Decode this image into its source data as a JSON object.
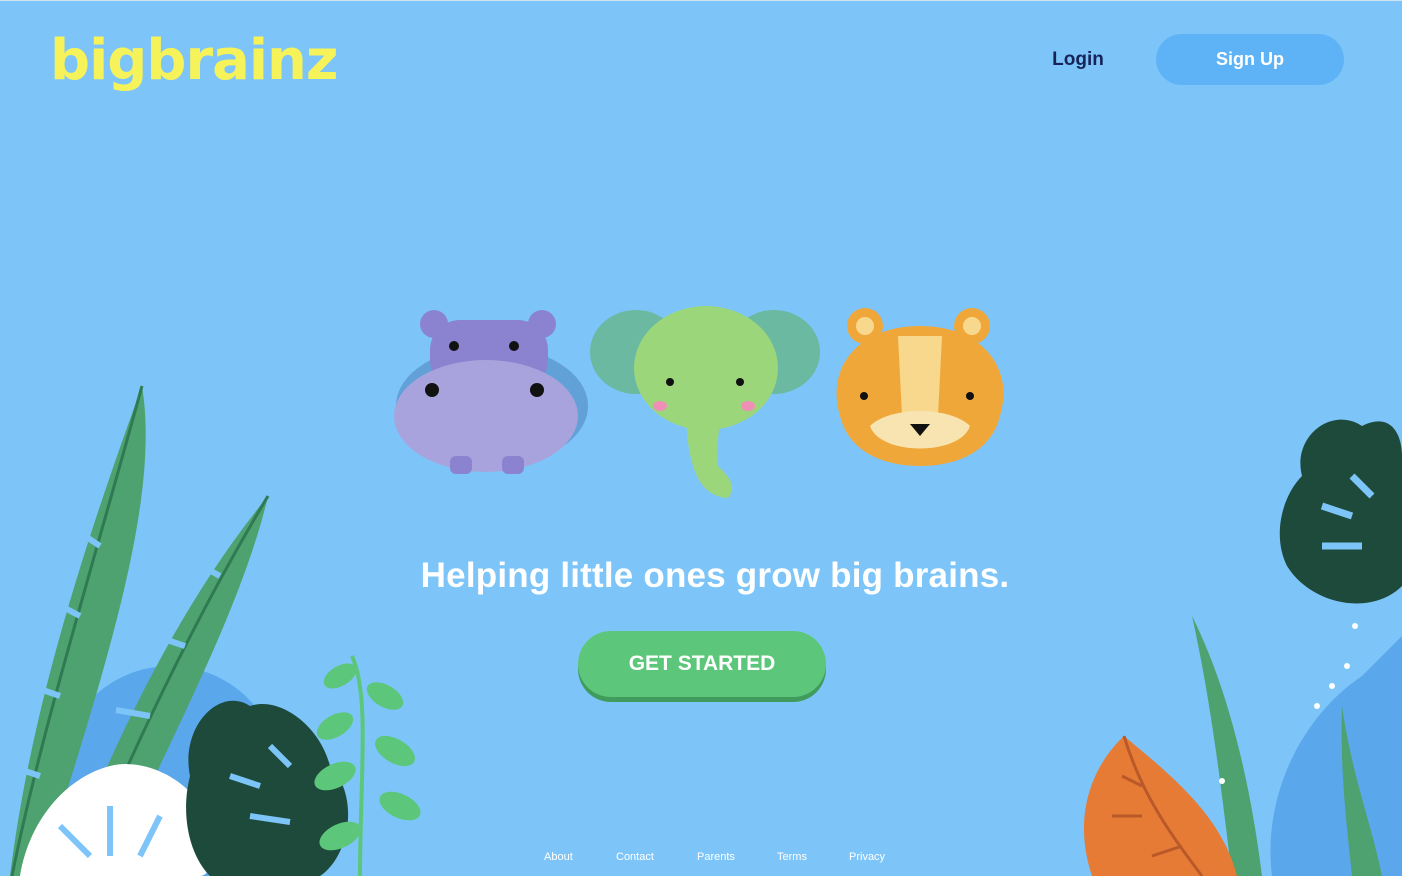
{
  "brand": {
    "logo_text": "bigbrainz"
  },
  "header": {
    "login_label": "Login",
    "signup_label": "Sign Up"
  },
  "hero": {
    "tagline": "Helping little ones grow big brains.",
    "cta_label": "GET STARTED"
  },
  "footer": {
    "links": [
      "About",
      "Contact",
      "Parents",
      "Terms",
      "Privacy"
    ]
  },
  "colors": {
    "background": "#7dc5f8",
    "logo": "#f6f25a",
    "signup_button": "#5eb3f6",
    "cta_button": "#5cc77a",
    "login_text": "#16245a"
  },
  "illustrations": [
    "hippo-icon",
    "elephant-icon",
    "tiger-icon",
    "jungle-leaves"
  ]
}
